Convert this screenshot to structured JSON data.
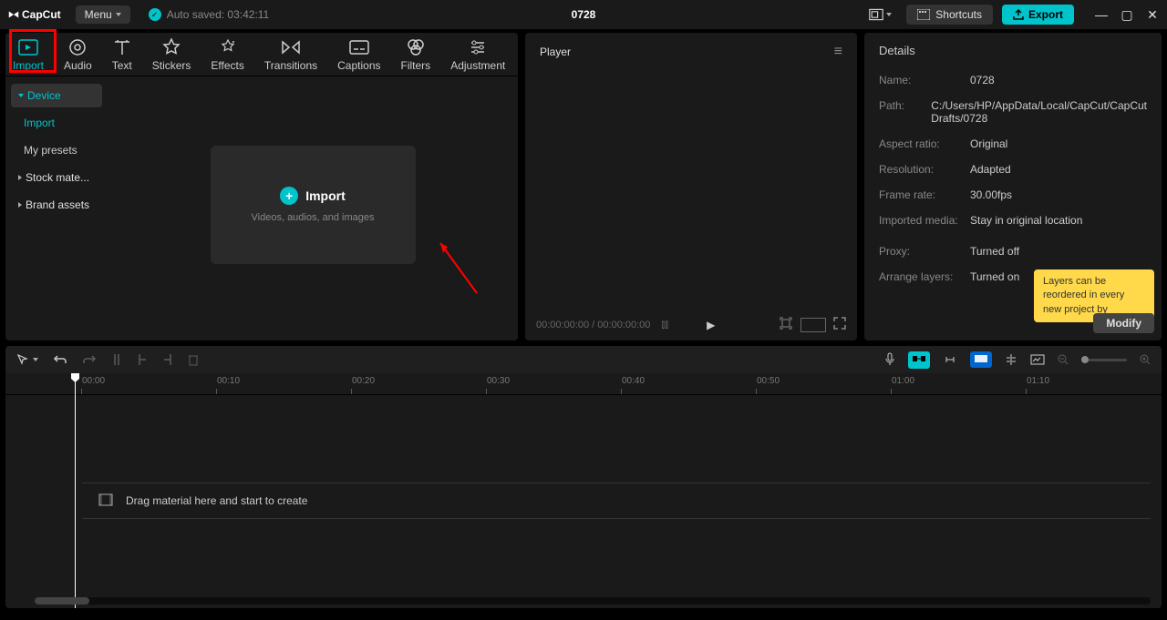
{
  "app_name": "CapCut",
  "menu_label": "Menu",
  "autosave": "Auto saved: 03:42:11",
  "project_title": "0728",
  "shortcuts_label": "Shortcuts",
  "export_label": "Export",
  "tabs": [
    {
      "label": "Import"
    },
    {
      "label": "Audio"
    },
    {
      "label": "Text"
    },
    {
      "label": "Stickers"
    },
    {
      "label": "Effects"
    },
    {
      "label": "Transitions"
    },
    {
      "label": "Captions"
    },
    {
      "label": "Filters"
    },
    {
      "label": "Adjustment"
    }
  ],
  "sidebar": {
    "device": "Device",
    "import": "Import",
    "presets": "My presets",
    "stock": "Stock mate...",
    "brand": "Brand assets"
  },
  "import_box": {
    "title": "Import",
    "sub": "Videos, audios, and images"
  },
  "player": {
    "title": "Player",
    "time_current": "00:00:00:00",
    "time_total": "00:00:00:00"
  },
  "details": {
    "title": "Details",
    "rows": {
      "name_label": "Name:",
      "name": "0728",
      "path_label": "Path:",
      "path": "C:/Users/HP/AppData/Local/CapCut/CapCut Drafts/0728",
      "aspect_label": "Aspect ratio:",
      "aspect": "Original",
      "res_label": "Resolution:",
      "res": "Adapted",
      "fps_label": "Frame rate:",
      "fps": "30.00fps",
      "media_label": "Imported media:",
      "media": "Stay in original location",
      "proxy_label": "Proxy:",
      "proxy": "Turned off",
      "layers_label": "Arrange layers:",
      "layers": "Turned on"
    },
    "tooltip": "Layers can be reordered in every new project by",
    "modify": "Modify"
  },
  "ruler": [
    "00:00",
    "00:10",
    "00:20",
    "00:30",
    "00:40",
    "00:50",
    "01:00",
    "01:10"
  ],
  "track_hint": "Drag material here and start to create"
}
